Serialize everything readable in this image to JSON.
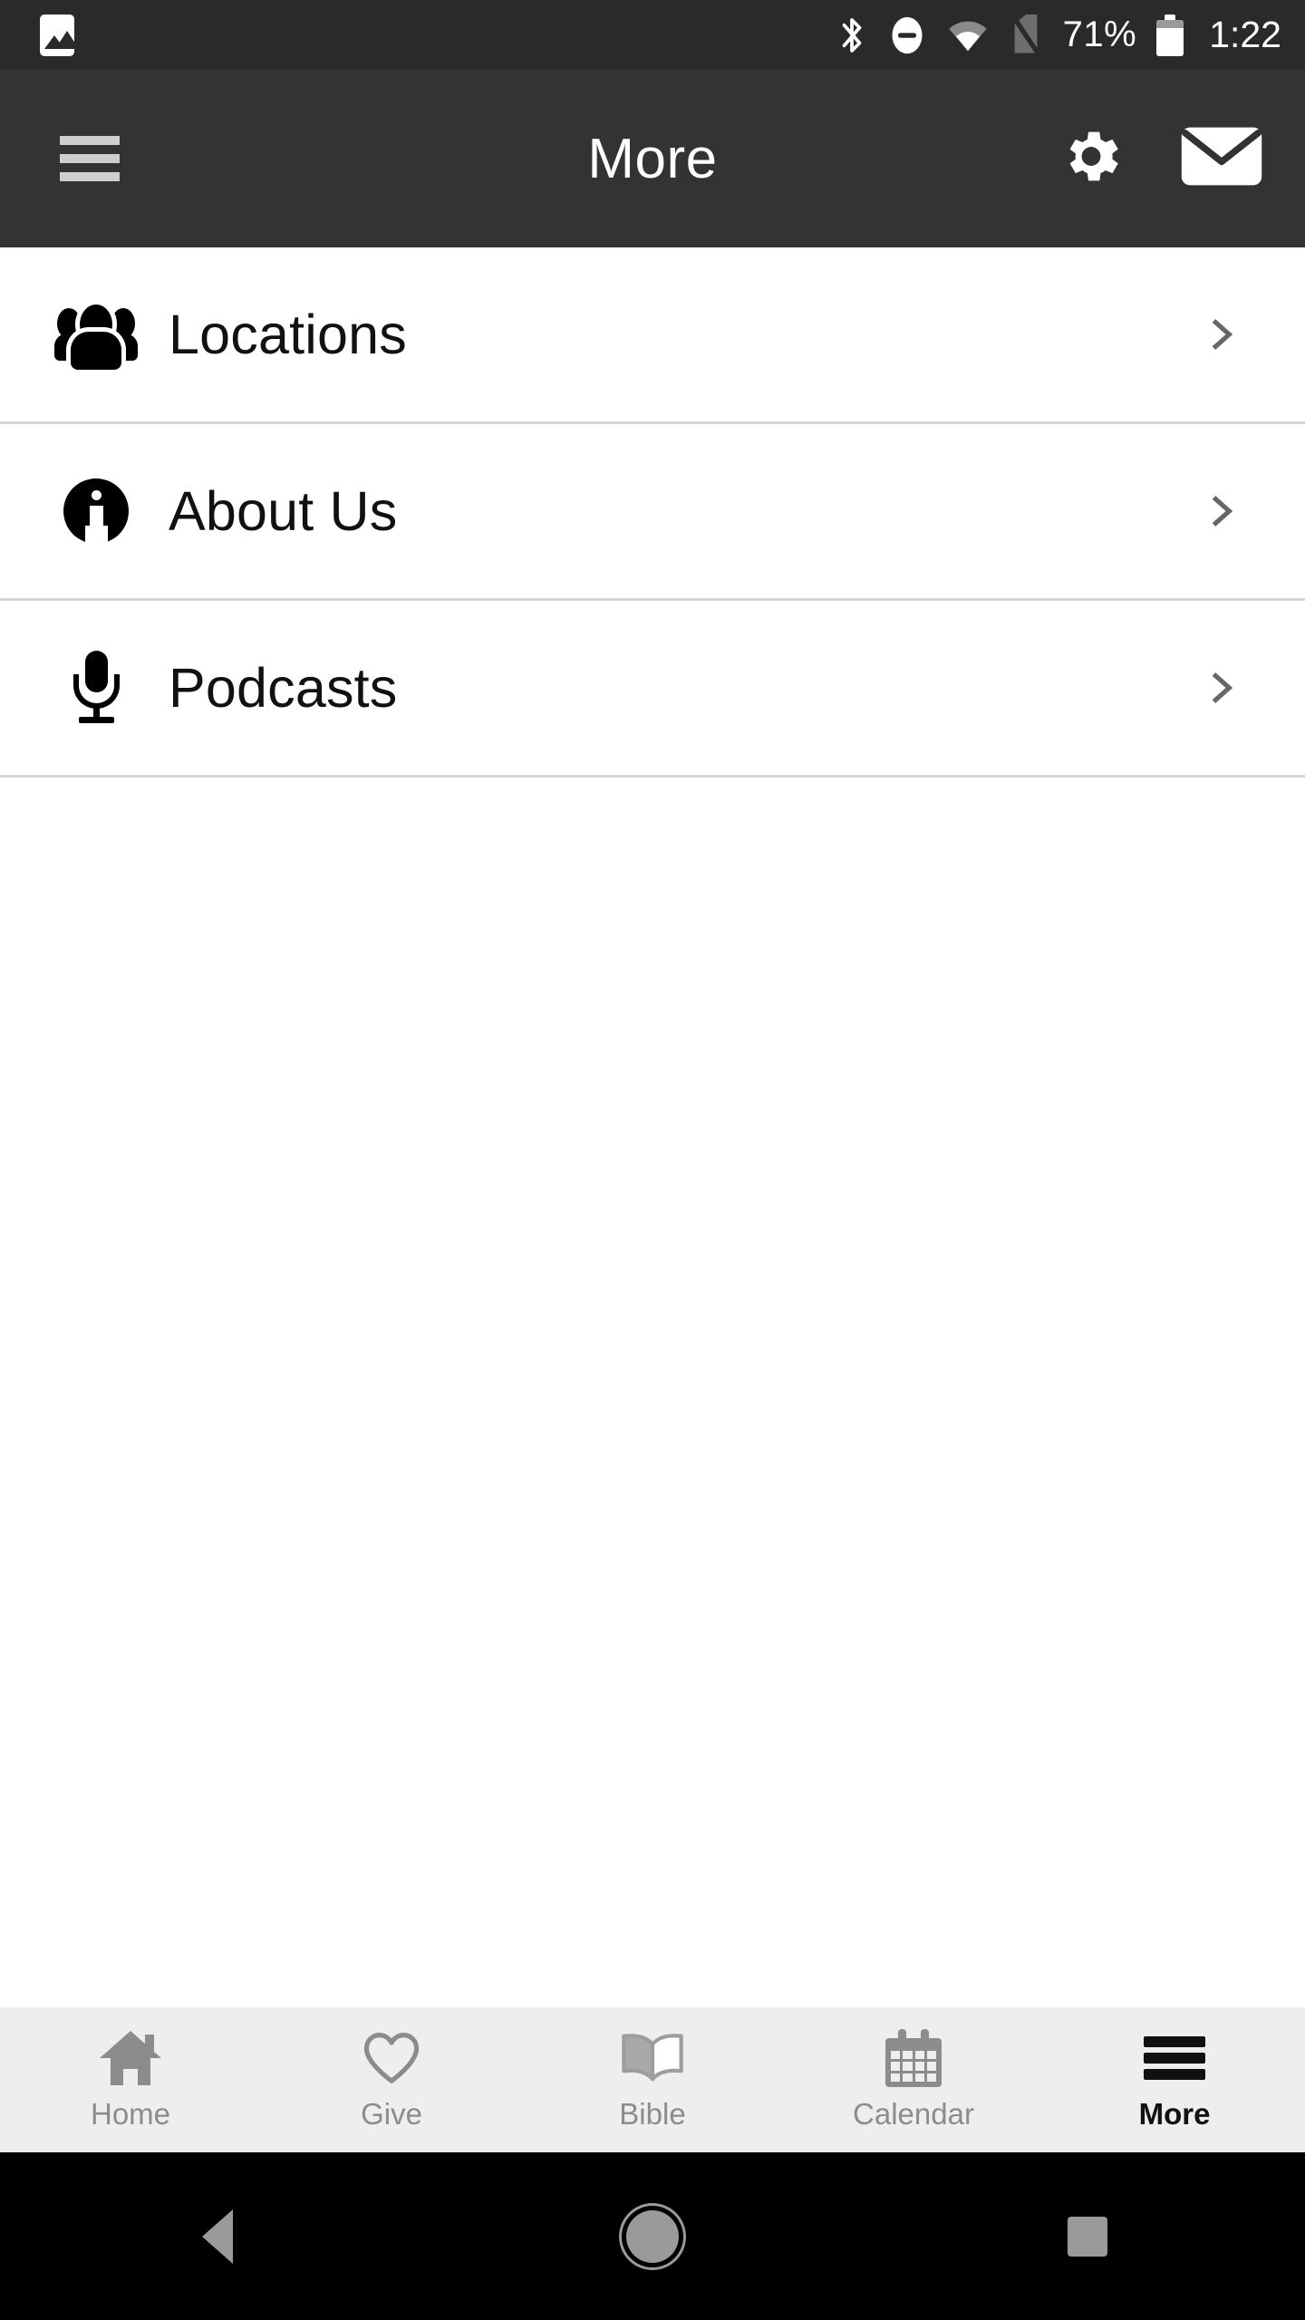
{
  "status_bar": {
    "left_icons": [
      "photo-icon"
    ],
    "right_icons": [
      "bluetooth-icon",
      "do-not-disturb-icon",
      "wifi-icon",
      "no-sim-icon"
    ],
    "battery_percent": "71%",
    "time": "1:22",
    "background_color": "#2a2a2a"
  },
  "app_bar": {
    "menu_icon": "hamburger-icon",
    "title": "More",
    "actions": [
      {
        "icon": "gear-icon",
        "name": "settings-button"
      },
      {
        "icon": "envelope-icon",
        "name": "mail-button"
      }
    ],
    "background_color": "#333333",
    "title_color": "#ffffff"
  },
  "list": {
    "items": [
      {
        "label": "Locations",
        "icon": "group-icon",
        "chevron": "chevron-right-icon"
      },
      {
        "label": "About Us",
        "icon": "info-circle-icon",
        "chevron": "chevron-right-icon"
      },
      {
        "label": "Podcasts",
        "icon": "microphone-icon",
        "chevron": "chevron-right-icon"
      }
    ],
    "divider_color": "#d4d4d4",
    "background_color": "#ffffff"
  },
  "tab_bar": {
    "background_color": "#eeeeee",
    "inactive_color": "#8c8c8c",
    "active_color": "#111111",
    "tabs": [
      {
        "label": "Home",
        "icon": "house-icon",
        "active": false
      },
      {
        "label": "Give",
        "icon": "heart-icon",
        "active": false
      },
      {
        "label": "Bible",
        "icon": "open-book-icon",
        "active": false
      },
      {
        "label": "Calendar",
        "icon": "calendar-icon",
        "active": false
      },
      {
        "label": "More",
        "icon": "hamburger-icon",
        "active": true
      }
    ]
  },
  "nav_bar": {
    "background_color": "#000000",
    "buttons": [
      "back-icon",
      "home-icon",
      "recents-icon"
    ]
  }
}
